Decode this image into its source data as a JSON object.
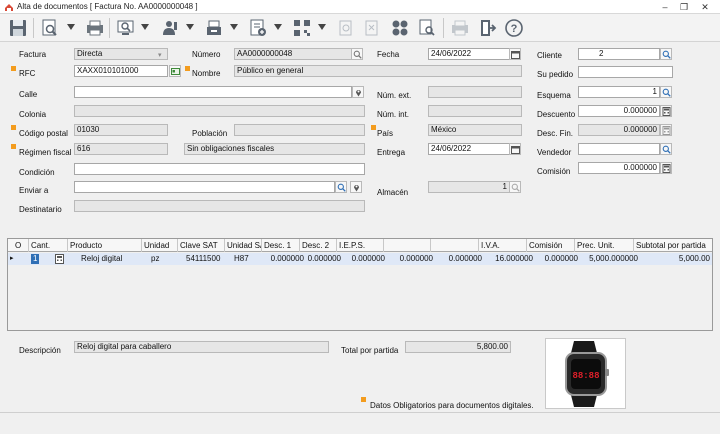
{
  "window": {
    "title": "Alta de documentos [ Factura No. AA0000000048 ]"
  },
  "form": {
    "factura": {
      "label": "Factura",
      "value": "Directa"
    },
    "numero": {
      "label": "Número",
      "value": "AA0000000048"
    },
    "fecha": {
      "label": "Fecha",
      "value": "24/06/2022"
    },
    "cliente": {
      "label": "Cliente",
      "value": "2"
    },
    "rfc": {
      "label": "RFC",
      "value": "XAXX010101000"
    },
    "nombre": {
      "label": "Nombre",
      "value": "Público en general"
    },
    "su_pedido": {
      "label": "Su pedido",
      "value": ""
    },
    "calle": {
      "label": "Calle",
      "value": ""
    },
    "num_ext": {
      "label": "Núm. ext.",
      "value": ""
    },
    "esquema": {
      "label": "Esquema",
      "value": "1"
    },
    "colonia": {
      "label": "Colonia",
      "value": ""
    },
    "num_int": {
      "label": "Núm. int.",
      "value": ""
    },
    "descuento": {
      "label": "Descuento",
      "value": "0.000000"
    },
    "codigo_postal": {
      "label": "Código postal",
      "value": "01030"
    },
    "poblacion": {
      "label": "Población",
      "value": ""
    },
    "pais": {
      "label": "País",
      "value": "México"
    },
    "desc_fin": {
      "label": "Desc. Fin.",
      "value": "0.000000"
    },
    "regimen_fiscal": {
      "label": "Régimen fiscal",
      "code": "616",
      "text": "Sin obligaciones fiscales"
    },
    "entrega": {
      "label": "Entrega",
      "value": "24/06/2022"
    },
    "vendedor": {
      "label": "Vendedor",
      "value": ""
    },
    "condicion": {
      "label": "Condición",
      "value": ""
    },
    "comision": {
      "label": "Comisión",
      "value": "0.000000"
    },
    "enviar_a": {
      "label": "Enviar a",
      "value": ""
    },
    "almacen": {
      "label": "Almacén",
      "value": "1"
    },
    "destinatario": {
      "label": "Destinatario",
      "value": ""
    }
  },
  "grid": {
    "columns": [
      "O",
      "Cant.",
      "Producto",
      "Unidad",
      "Clave SAT",
      "Unidad SAT",
      "Desc. 1",
      "Desc. 2",
      "I.E.P.S.",
      "",
      "",
      "I.V.A.",
      "Comisión",
      "Prec. Unit.",
      "Subtotal por partida"
    ],
    "rows": [
      [
        "",
        "1",
        "Reloj digital",
        "pz",
        "54111500",
        "H87",
        "0.000000",
        "0.000000",
        "0.000000",
        "0.000000",
        "0.000000",
        "16.000000",
        "0.000000",
        "5,000.000000",
        "5,000.00"
      ]
    ]
  },
  "footer": {
    "descripcion_label": "Descripción",
    "descripcion_value": "Reloj digital para caballero",
    "total_label": "Total por partida",
    "total_value": "5,800.00",
    "legend": "Datos Obligatorios para documentos digitales."
  },
  "colors": {
    "required": "#f39c1e",
    "accent": "#2f6fb5",
    "selected_row": "#dfe8f7"
  }
}
